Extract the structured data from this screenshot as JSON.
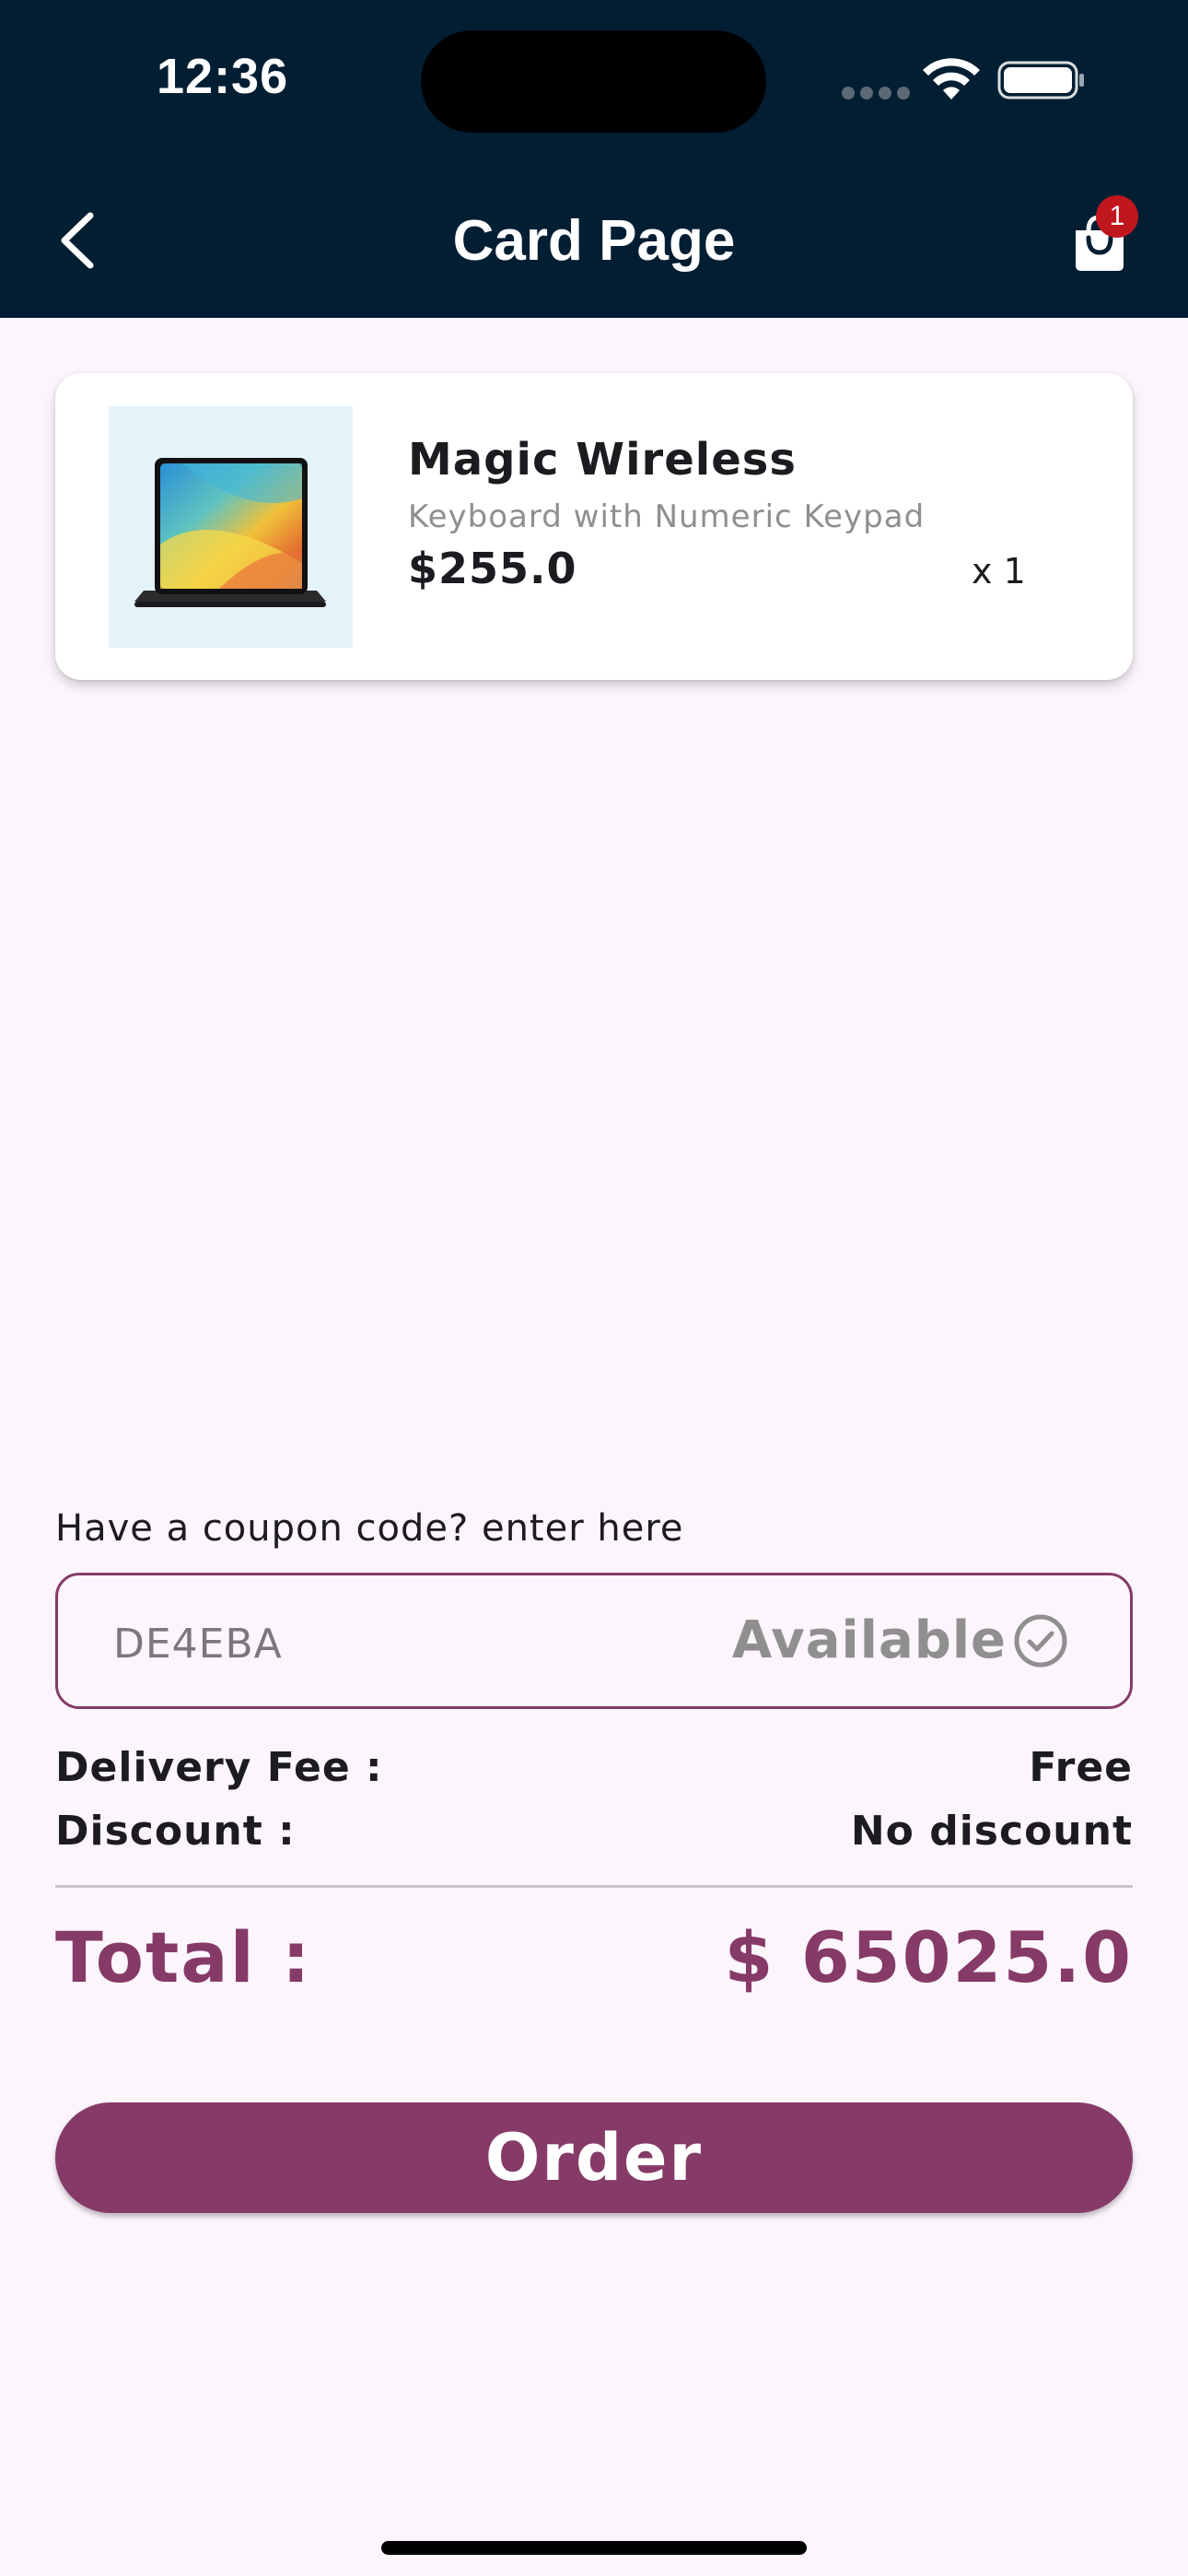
{
  "status_bar": {
    "time": "12:36"
  },
  "app_bar": {
    "title": "Card Page",
    "back_icon": "chevron-left-icon",
    "cart_icon": "shopping-bag-icon",
    "cart_badge_count": "1"
  },
  "cart_items": [
    {
      "name": "Magic Wireless",
      "subtitle": "Keyboard with Numeric Keypad",
      "price": "$255.0",
      "quantity": "x 1",
      "image": "ipad-with-keyboard"
    }
  ],
  "coupon": {
    "prompt": "Have a coupon code? enter here",
    "code": "DE4EBA",
    "status": "Available",
    "status_icon": "check-circle-icon"
  },
  "summary": {
    "delivery_label": "Delivery Fee :",
    "delivery_value": "Free",
    "discount_label": "Discount :",
    "discount_value": "No discount",
    "total_label": "Total :",
    "total_value": "$ 65025.0"
  },
  "order_button": {
    "label": "Order"
  },
  "colors": {
    "header_bg": "#021e33",
    "page_bg": "#fcf5fc",
    "accent": "#853a68",
    "badge": "#c0161e"
  }
}
